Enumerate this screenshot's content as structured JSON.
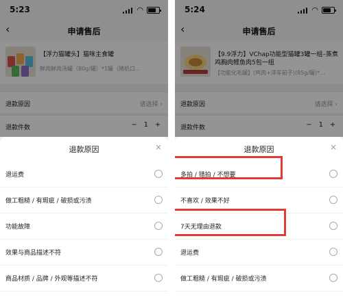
{
  "screens": [
    {
      "time": "5:23",
      "header_title": "申请售后",
      "product": {
        "name": "【浮力猫罐头】猫咪主食罐",
        "spec": "鲜肉鲜肉汤罐（80g/罐）*1罐（随机口..."
      },
      "rows": {
        "reason_label": "退款原因",
        "reason_value": "请选择 ›",
        "count_label": "退款件数",
        "minus": "−",
        "quantity": "1",
        "plus": "+"
      },
      "sheet": {
        "title": "退款原因",
        "close": "×",
        "options": [
          "退运费",
          "做工粗糙 / 有瑕疵 / 破损或污渍",
          "功能故障",
          "效果与商品描述不符",
          "商品材质 / 品牌 / 外观等描述不符",
          ""
        ]
      }
    },
    {
      "time": "5:24",
      "header_title": "申请售后",
      "product": {
        "name": "【9.9浮力】VChap功能型猫罐3罐一组–蒸煮鸡胸肉鲣鱼肉5包一组",
        "spec": "【功能化毛罐】(鸡肉+洋车前子)(85g/罐)*..."
      },
      "rows": {
        "reason_label": "退款原因",
        "reason_value": "请选择 ›",
        "count_label": "退款件数",
        "minus": "−",
        "quantity": "1",
        "plus": "+"
      },
      "sheet": {
        "title": "退款原因",
        "close": "×",
        "options": [
          "多拍 / 错拍 / 不想要",
          "不喜欢 / 效果不好",
          "7天无理由退款",
          "退运费",
          "做工粗糙 / 有瑕疵 / 破损或污渍",
          ""
        ]
      }
    }
  ],
  "highlight_color": "#e53935"
}
